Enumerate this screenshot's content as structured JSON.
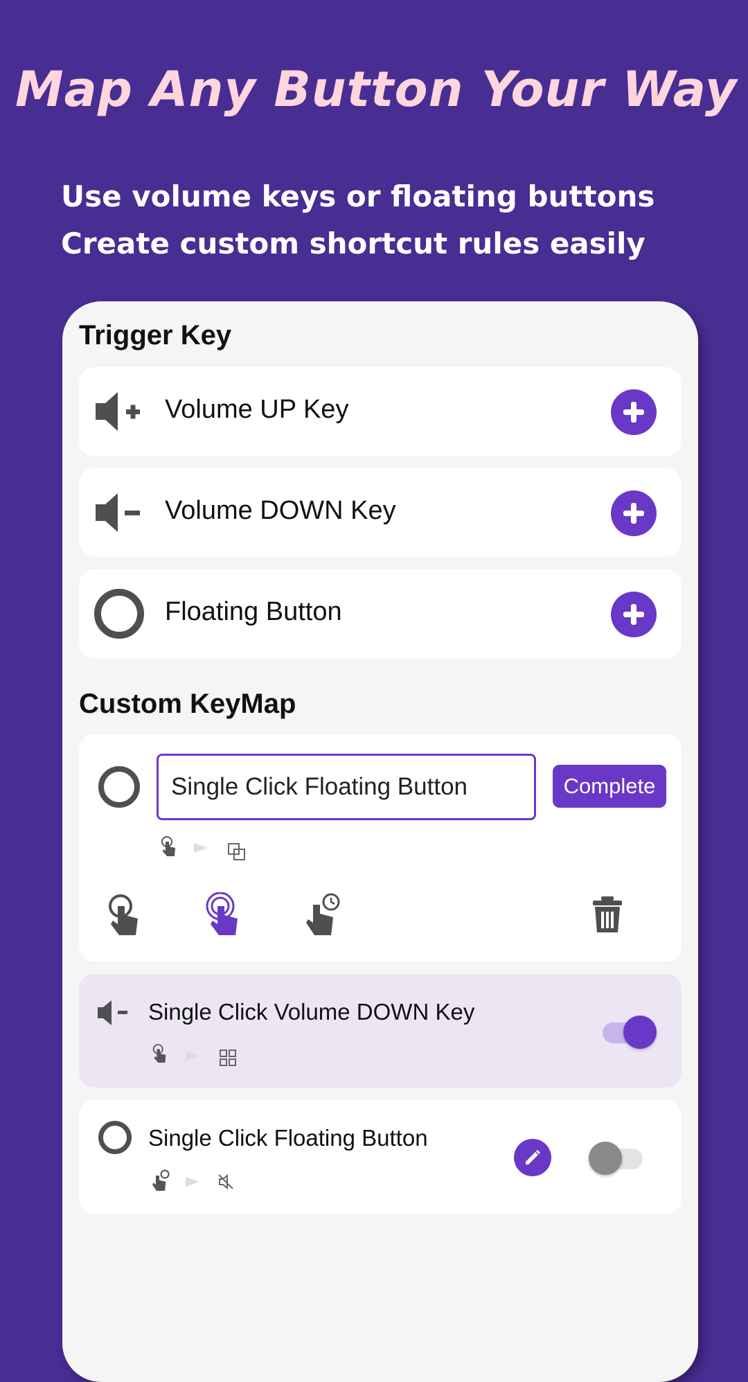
{
  "hero": {
    "headline": "Map Any Button Your Way",
    "subtitle_line1": "Use volume keys or floating buttons",
    "subtitle_line2": "Create custom shortcut rules easily"
  },
  "trigger_section": {
    "title": "Trigger Key",
    "items": [
      {
        "label": "Volume UP Key",
        "icon": "volume-up-icon"
      },
      {
        "label": "Volume DOWN Key",
        "icon": "volume-down-icon"
      },
      {
        "label": "Floating Button",
        "icon": "floating-button-icon"
      }
    ]
  },
  "keymap_section": {
    "title": "Custom KeyMap",
    "editor": {
      "input_value": "Single Click Floating Button",
      "complete_label": "Complete",
      "selected_action": "double-click"
    },
    "mappings": [
      {
        "label": "Single Click Volume DOWN Key",
        "enabled": true,
        "highlighted": true
      },
      {
        "label": "Single Click Floating Button",
        "enabled": false,
        "highlighted": false
      }
    ]
  },
  "colors": {
    "background": "#482d93",
    "accent": "#6a38c7",
    "headline": "#ffd6de",
    "highlight_card": "#ece6f4"
  }
}
